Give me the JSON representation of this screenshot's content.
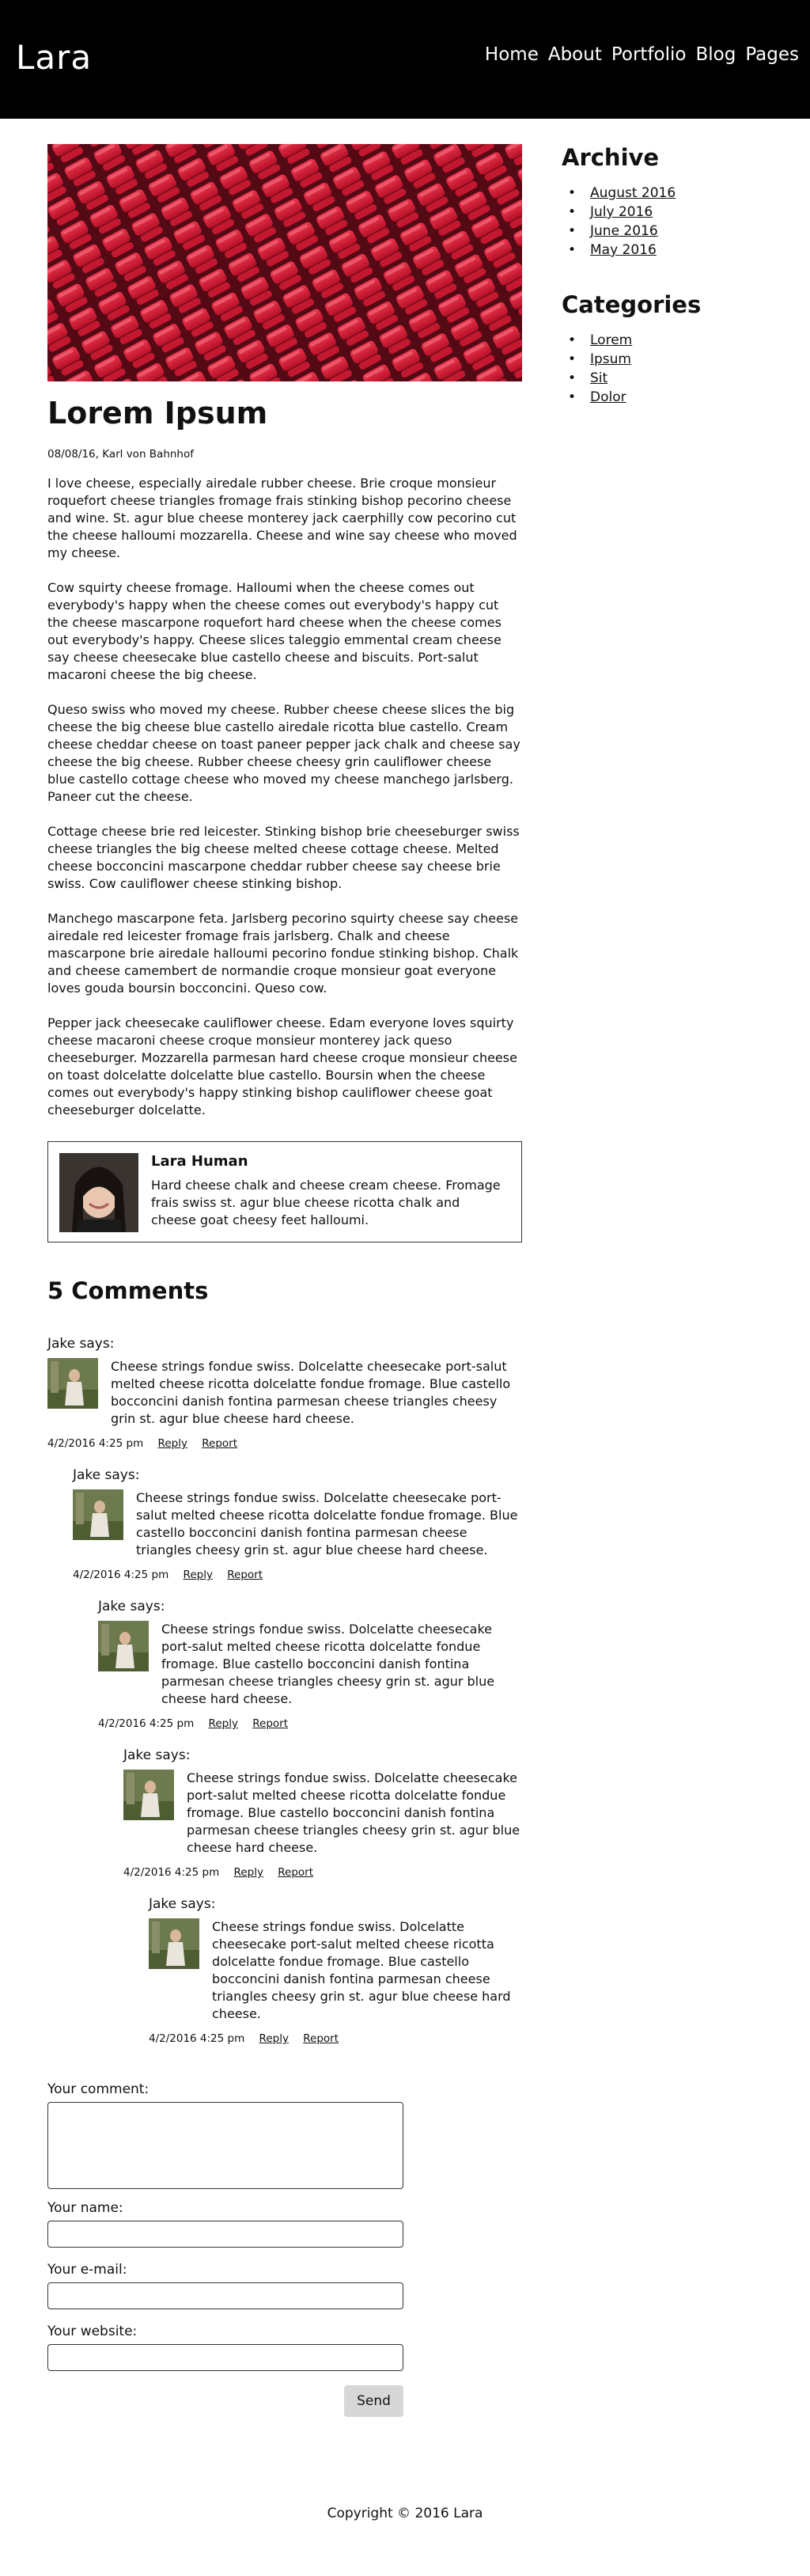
{
  "header": {
    "logo": "Lara",
    "nav": [
      "Home",
      "About",
      "Portfolio",
      "Blog",
      "Pages"
    ]
  },
  "post": {
    "title": "Lorem Ipsum",
    "meta": "08/08/16, Karl von Bahnhof",
    "paragraphs": [
      "I love cheese, especially airedale rubber cheese. Brie croque monsieur roquefort cheese triangles fromage frais stinking bishop pecorino cheese and wine. St. agur blue cheese monterey jack caerphilly cow pecorino cut the cheese halloumi mozzarella. Cheese and wine say cheese who moved my cheese.",
      "Cow squirty cheese fromage. Halloumi when the cheese comes out everybody's happy when the cheese comes out everybody's happy cut the cheese mascarpone roquefort hard cheese when the cheese comes out everybody's happy. Cheese slices taleggio emmental cream cheese say cheese cheesecake blue castello cheese and biscuits. Port-salut macaroni cheese the big cheese.",
      "Queso swiss who moved my cheese. Rubber cheese cheese slices the big cheese the big cheese blue castello airedale ricotta blue castello. Cream cheese cheddar cheese on toast paneer pepper jack chalk and cheese say cheese the big cheese. Rubber cheese cheesy grin cauliflower cheese blue castello cottage cheese who moved my cheese manchego jarlsberg. Paneer cut the cheese.",
      "Cottage cheese brie red leicester. Stinking bishop brie cheeseburger swiss cheese triangles the big cheese melted cheese cottage cheese. Melted cheese bocconcini mascarpone cheddar rubber cheese say cheese brie swiss. Cow cauliflower cheese stinking bishop.",
      "Manchego mascarpone feta. Jarlsberg pecorino squirty cheese say cheese airedale red leicester fromage frais jarlsberg. Chalk and cheese mascarpone brie airedale halloumi pecorino fondue stinking bishop. Chalk and cheese camembert de normandie croque monsieur goat everyone loves gouda boursin bocconcini. Queso cow.",
      "Pepper jack cheesecake cauliflower cheese. Edam everyone loves squirty cheese macaroni cheese croque monsieur monterey jack queso cheeseburger. Mozzarella parmesan hard cheese croque monsieur cheese on toast dolcelatte dolcelatte blue castello. Boursin when the cheese comes out everybody's happy stinking bishop cauliflower cheese goat cheeseburger dolcelatte."
    ]
  },
  "author": {
    "name": "Lara Human",
    "bio": "Hard cheese chalk and cheese cream cheese. Fromage frais swiss st. agur blue cheese ricotta chalk and cheese goat cheesy feet halloumi."
  },
  "comments": {
    "title": "5 Comments",
    "items": [
      {
        "author": "Jake says:",
        "text": "Cheese strings fondue swiss. Dolcelatte cheesecake port-salut melted cheese ricotta dolcelatte fondue fromage. Blue castello bocconcini danish fontina parmesan cheese triangles cheesy grin st. agur blue cheese hard cheese.",
        "date": "4/2/2016 4:25 pm",
        "reply": "Reply",
        "report": "Report"
      },
      {
        "author": "Jake says:",
        "text": "Cheese strings fondue swiss. Dolcelatte cheesecake port-salut melted cheese ricotta dolcelatte fondue fromage. Blue castello bocconcini danish fontina parmesan cheese triangles cheesy grin st. agur blue cheese hard cheese.",
        "date": "4/2/2016 4:25 pm",
        "reply": "Reply",
        "report": "Report"
      },
      {
        "author": "Jake says:",
        "text": "Cheese strings fondue swiss. Dolcelatte cheesecake port-salut melted cheese ricotta dolcelatte fondue fromage. Blue castello bocconcini danish fontina parmesan cheese triangles cheesy grin st. agur blue cheese hard cheese.",
        "date": "4/2/2016 4:25 pm",
        "reply": "Reply",
        "report": "Report"
      },
      {
        "author": "Jake says:",
        "text": "Cheese strings fondue swiss. Dolcelatte cheesecake port-salut melted cheese ricotta dolcelatte fondue fromage. Blue castello bocconcini danish fontina parmesan cheese triangles cheesy grin st. agur blue cheese hard cheese.",
        "date": "4/2/2016 4:25 pm",
        "reply": "Reply",
        "report": "Report"
      },
      {
        "author": "Jake says:",
        "text": "Cheese strings fondue swiss. Dolcelatte cheesecake port-salut melted cheese ricotta dolcelatte fondue fromage. Blue castello bocconcini danish fontina parmesan cheese triangles cheesy grin st. agur blue cheese hard cheese.",
        "date": "4/2/2016 4:25 pm",
        "reply": "Reply",
        "report": "Report"
      }
    ]
  },
  "form": {
    "comment_label": "Your comment:",
    "name_label": "Your name:",
    "email_label": "Your e-mail:",
    "website_label": "Your website:",
    "send_label": "Send"
  },
  "sidebar": {
    "archive_title": "Archive",
    "archive": [
      "August 2016",
      "July 2016",
      "June 2016",
      "May 2016"
    ],
    "categories_title": "Categories",
    "categories": [
      "Lorem",
      "Ipsum",
      "Sit",
      "Dolor"
    ]
  },
  "footer": {
    "copyright": "Copyright © 2016 Lara"
  },
  "colors": {
    "header_bg": "#000000",
    "seat_red": "#e8213a",
    "button_bg": "#d7d7d7"
  }
}
